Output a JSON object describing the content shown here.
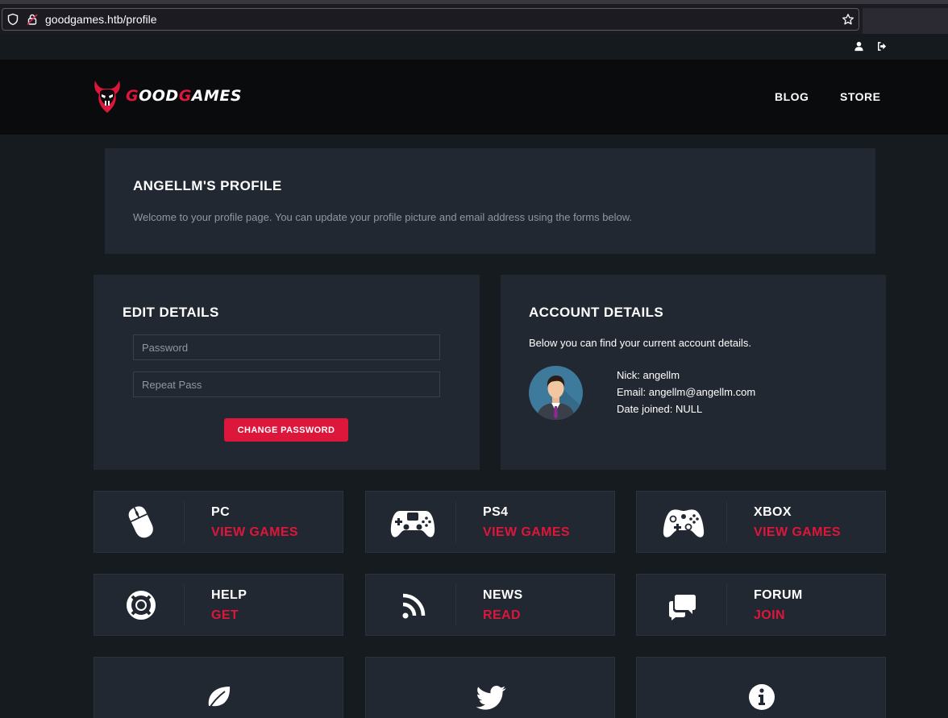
{
  "browser": {
    "url": "goodgames.htb/profile"
  },
  "topbar": {
    "icons": [
      "user-icon",
      "logout-icon"
    ]
  },
  "nav": {
    "logo_prefix_red": "G",
    "logo_mid": "OOD",
    "logo_mid_red": "G",
    "logo_end": "AMES",
    "links": [
      "BLOG",
      "STORE"
    ]
  },
  "profile": {
    "title": "ANGELLM'S PROFILE",
    "description": "Welcome to your profile page. You can update your profile picture and email address using the forms below."
  },
  "edit": {
    "title": "EDIT DETAILS",
    "password_placeholder": "Password",
    "repeat_placeholder": "Repeat Pass",
    "button": "CHANGE PASSWORD"
  },
  "account": {
    "title": "ACCOUNT DETAILS",
    "subtitle": "Below you can find your current account details.",
    "nick": "Nick: angellm",
    "email": "Email: angellm@angellm.com",
    "date_joined": "Date joined: NULL"
  },
  "tiles": [
    {
      "title": "PC",
      "action": "VIEW GAMES",
      "icon": "mouse-icon"
    },
    {
      "title": "PS4",
      "action": "VIEW GAMES",
      "icon": "ps4-controller-icon"
    },
    {
      "title": "XBOX",
      "action": "VIEW GAMES",
      "icon": "xbox-controller-icon"
    },
    {
      "title": "HELP",
      "action": "GET",
      "icon": "lifebuoy-icon"
    },
    {
      "title": "NEWS",
      "action": "READ",
      "icon": "rss-icon"
    },
    {
      "title": "FORUM",
      "action": "JOIN",
      "icon": "chat-icon"
    }
  ],
  "bottom_tiles": [
    {
      "icon": "leaf-icon"
    },
    {
      "icon": "twitter-icon"
    },
    {
      "icon": "info-icon"
    }
  ],
  "colors": {
    "accent": "#dd163b",
    "page_bg": "#161b1f",
    "panel_bg": "#222831",
    "nav_bg": "#090b0c"
  }
}
